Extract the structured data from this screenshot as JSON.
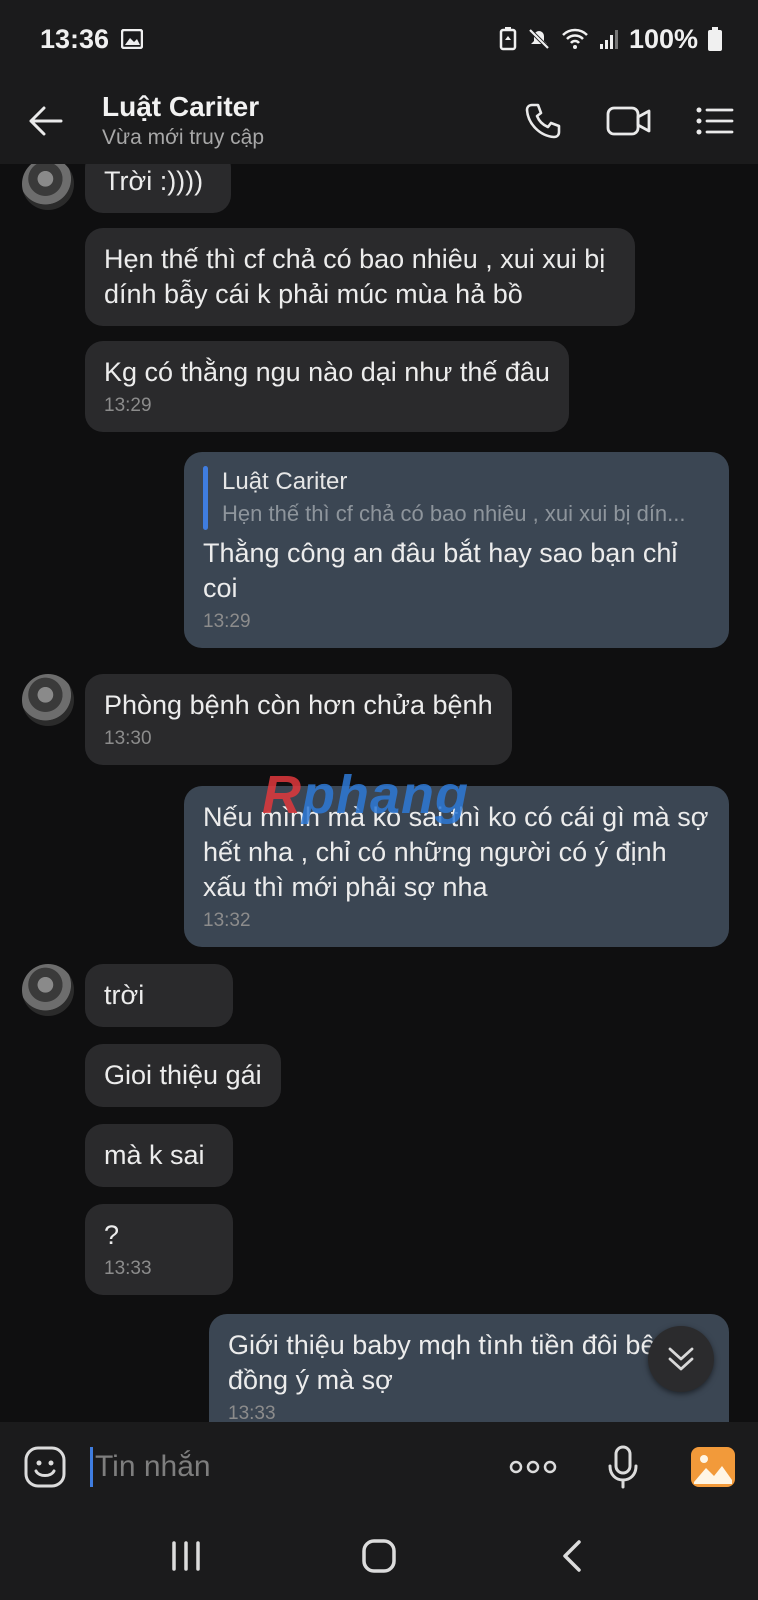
{
  "status_bar": {
    "time": "13:36",
    "battery": "100%"
  },
  "header": {
    "name": "Luật Cariter",
    "status": "Vừa mới truy cập"
  },
  "messages": [
    {
      "dir": "in",
      "text": "Trời :))))",
      "time": ""
    },
    {
      "dir": "in",
      "text": "Hẹn thế thì cf chả có bao nhiêu , xui xui bị dính bẫy cái k phải múc mùa hả bồ",
      "time": ""
    },
    {
      "dir": "in",
      "text": "Kg có thằng ngu nào dại như thế đâu",
      "time": "13:29"
    },
    {
      "dir": "out",
      "quote_name": "Luật Cariter",
      "quote_text": "Hẹn thế thì cf chả có bao nhiêu , xui xui bị dín...",
      "text": "Thằng công an đâu bắt hay sao bạn chỉ coi",
      "time": "13:29"
    },
    {
      "dir": "in",
      "text": "Phòng bệnh còn hơn chửa bệnh",
      "time": "13:30"
    },
    {
      "dir": "out",
      "text": "Nếu mình mà ko sai thì ko có cái gì mà sợ hết nha , chỉ có những người có ý định xấu thì mới phải sợ nha",
      "time": "13:32"
    },
    {
      "dir": "in",
      "text": "trời",
      "time": ""
    },
    {
      "dir": "in",
      "text": "Gioi thiệu gái",
      "time": ""
    },
    {
      "dir": "in",
      "text": "mà k sai",
      "time": ""
    },
    {
      "dir": "in",
      "text": "?",
      "time": "13:33"
    },
    {
      "dir": "out",
      "text": "Giới thiệu baby mqh tình tiền đôi bên đồng ý mà sợ",
      "time": "13:33"
    }
  ],
  "watermark": {
    "part1": "R",
    "part2": "phang"
  },
  "input": {
    "placeholder": "Tin nhắn"
  },
  "icons": {
    "back": "arrow-left-icon",
    "call": "phone-icon",
    "video": "video-camera-icon",
    "menu": "list-menu-icon",
    "emoji": "emoji-icon",
    "more": "more-dots-icon",
    "mic": "microphone-icon",
    "gallery": "image-icon",
    "scroll": "chevron-double-down-icon"
  },
  "colors": {
    "incoming_bubble": "#2a2a2c",
    "outgoing_bubble": "#3b4653",
    "accent": "#3f7de0",
    "gallery_icon": "#f29a3a"
  }
}
